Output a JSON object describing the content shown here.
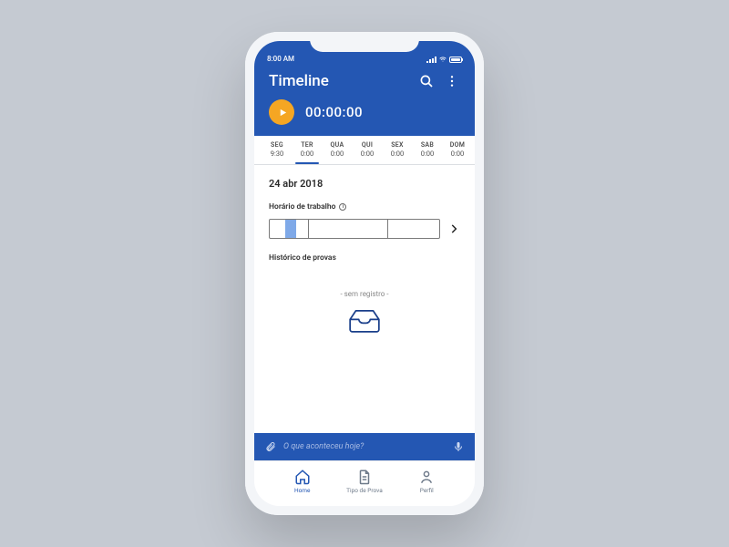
{
  "colors": {
    "primary": "#2457b3",
    "accent": "#f5a623",
    "barFill": "#7fa9e8"
  },
  "status": {
    "time": "8:00 AM"
  },
  "header": {
    "title": "Timeline",
    "timer": "00:00:00"
  },
  "days": [
    {
      "name": "SEG",
      "time": "9:30",
      "active": false
    },
    {
      "name": "TER",
      "time": "0:00",
      "active": true
    },
    {
      "name": "QUA",
      "time": "0:00",
      "active": false
    },
    {
      "name": "QUI",
      "time": "0:00",
      "active": false
    },
    {
      "name": "SEX",
      "time": "0:00",
      "active": false
    },
    {
      "name": "SAB",
      "time": "0:00",
      "active": false
    },
    {
      "name": "DOM",
      "time": "0:00",
      "active": false
    }
  ],
  "content": {
    "date": "24 abr 2018",
    "work_label": "Horário de trabalho",
    "work_segments": [
      {
        "widthPct": 23,
        "fillLeftPct": 40,
        "fillWidthPct": 30
      },
      {
        "widthPct": 47,
        "fillLeftPct": 0,
        "fillWidthPct": 0
      },
      {
        "widthPct": 30,
        "fillLeftPct": 0,
        "fillWidthPct": 0
      }
    ],
    "history_label": "Histórico de provas",
    "empty_text": "- sem registro -"
  },
  "note": {
    "placeholder": "O que aconteceu hoje?"
  },
  "tabs": [
    {
      "key": "home",
      "label": "Home",
      "active": true
    },
    {
      "key": "tipo",
      "label": "Tipo de Prova",
      "active": false
    },
    {
      "key": "perfil",
      "label": "Perfil",
      "active": false
    }
  ]
}
